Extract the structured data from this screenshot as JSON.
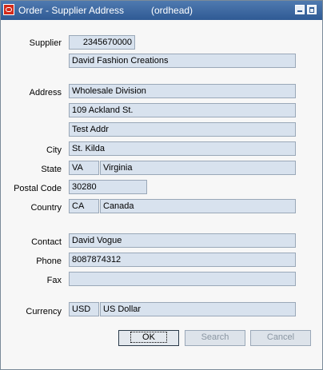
{
  "window": {
    "title": "Order - Supplier Address",
    "subtitle": "(ordhead)",
    "logo_icon": "oracle-logo-icon",
    "minimize_icon": "minimize-icon",
    "maximize_icon": "maximize-icon"
  },
  "labels": {
    "supplier": "Supplier",
    "address": "Address",
    "city": "City",
    "state": "State",
    "postal_code": "Postal Code",
    "country": "Country",
    "contact": "Contact",
    "phone": "Phone",
    "fax": "Fax",
    "currency": "Currency"
  },
  "fields": {
    "supplier_id": "2345670000",
    "supplier_name": "David Fashion Creations",
    "address_line1": "Wholesale Division",
    "address_line2": "109 Ackland St.",
    "address_line3": "Test Addr",
    "city": "St. Kilda",
    "state_code": "VA",
    "state_name": "Virginia",
    "postal_code": "30280",
    "country_code": "CA",
    "country_name": "Canada",
    "contact": "David Vogue",
    "phone": "8087874312",
    "fax": "",
    "currency_code": "USD",
    "currency_name": "US Dollar"
  },
  "buttons": {
    "ok": "OK",
    "search": "Search",
    "cancel": "Cancel"
  }
}
